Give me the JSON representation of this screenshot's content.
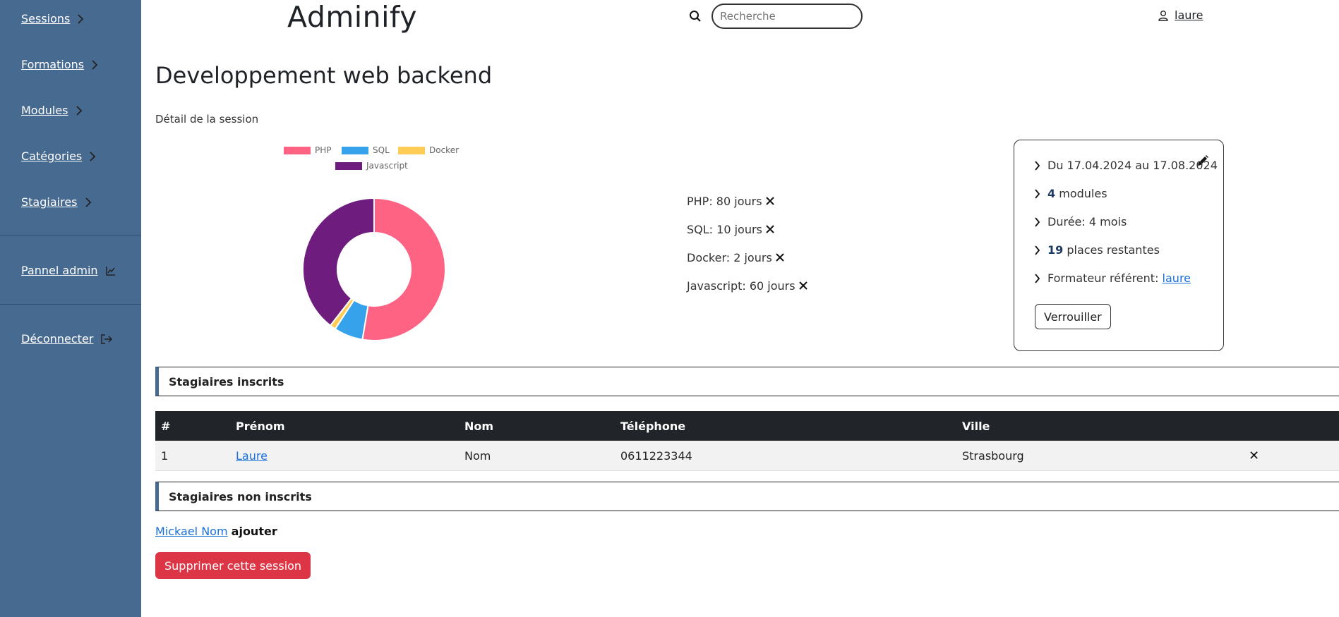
{
  "sidebar": {
    "items": [
      {
        "label": "Sessions"
      },
      {
        "label": "Formations"
      },
      {
        "label": "Modules"
      },
      {
        "label": "Catégories"
      },
      {
        "label": "Stagiaires"
      }
    ],
    "admin_label": "Pannel admin",
    "logout_label": "Déconnecter"
  },
  "header": {
    "brand": "Adminify",
    "search_placeholder": "Recherche",
    "user_name": "laure"
  },
  "page": {
    "title": "Developpement web backend",
    "subtitle": "Détail de la session"
  },
  "chart_data": {
    "type": "pie",
    "categories": [
      "PHP",
      "SQL",
      "Docker",
      "Javascript"
    ],
    "values": [
      80,
      10,
      2,
      60
    ],
    "colors": [
      "#ff6384",
      "#36a2eb",
      "#ffcd56",
      "#6e1c7e"
    ],
    "legend": "top",
    "donut": true
  },
  "durations": [
    {
      "text": "PHP: 80 jours"
    },
    {
      "text": "SQL: 10 jours"
    },
    {
      "text": "Docker: 2 jours"
    },
    {
      "text": "Javascript: 60 jours"
    }
  ],
  "info": {
    "dates": "Du 17.04.2024 au 17.08.2024",
    "modules_count": "4",
    "modules_label": " modules",
    "duration": "Durée: 4 mois",
    "places_count": "19",
    "places_label": " places restantes",
    "trainer_label": "Formateur référent: ",
    "trainer_name": "laure",
    "lock_label": "Verrouiller"
  },
  "enrolled": {
    "title": "Stagiaires inscrits",
    "headers": [
      "#",
      "Prénom",
      "Nom",
      "Téléphone",
      "Ville"
    ],
    "rows": [
      {
        "num": "1",
        "first": "Laure",
        "last": "Nom",
        "phone": "0611223344",
        "city": "Strasbourg"
      }
    ]
  },
  "not_enrolled": {
    "title": "Stagiaires non inscrits",
    "name": "Mickael Nom",
    "add_label": "ajouter"
  },
  "delete_label": "Supprimer cette session"
}
